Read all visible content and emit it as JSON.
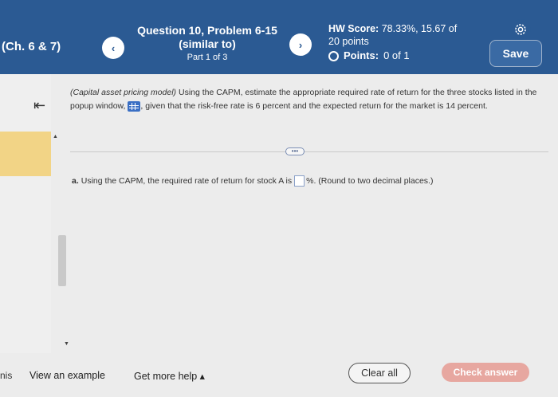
{
  "header": {
    "chapter": "(Ch. 6 & 7)",
    "prev_icon": "‹",
    "next_icon": "›",
    "question_title": "Question 10, Problem 6-15",
    "question_sub": "(similar to)",
    "part": "Part 1 of 3",
    "hw_score_label": "HW Score:",
    "hw_score_value": "78.33%, 15.67 of",
    "hw_score_points": "20 points",
    "points_label": "Points:",
    "points_value": "0 of 1",
    "save_label": "Save"
  },
  "content": {
    "collapse_icon": "⇤",
    "intro_italic": "(Capital asset pricing model)",
    "intro_text_1": " Using the CAPM, estimate the appropriate required rate of return for the three stocks listed in the popup window, ",
    "intro_text_2": ", given that the risk-free rate is 6 percent and the expected return for the market is 14 percent.",
    "more_label": "•••",
    "part_a_label": "a.",
    "part_a_text": "Using the CAPM, the required rate of return for stock A is",
    "part_a_suffix": "%.  (Round to two decimal places.)"
  },
  "footer": {
    "cut_text": "nis",
    "example_label": "View an example",
    "help_label": "Get more help ▴",
    "clear_label": "Clear all",
    "check_label": "Check answer"
  },
  "colors": {
    "header_bg": "#2b5a93",
    "highlight": "#f2d486",
    "check_button": "#e7a7a0"
  }
}
